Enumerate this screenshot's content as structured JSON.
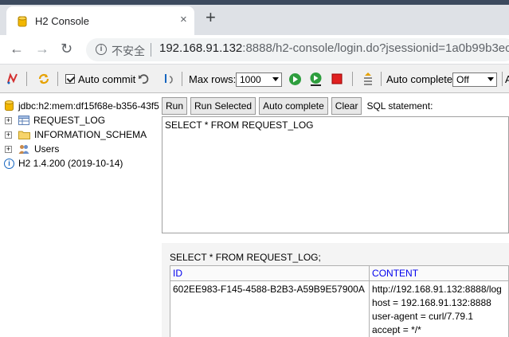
{
  "browser": {
    "tab_title": "H2 Console",
    "tab_close": "×",
    "new_tab": "+",
    "insecure_label": "不安全",
    "url_host": "192.168.91.132",
    "url_rest": ":8888/h2-console/login.do?jsessionid=1a0b99b3ec"
  },
  "toolbar": {
    "auto_commit_label": "Auto commit",
    "max_rows_label": "Max rows:",
    "max_rows_value": "1000",
    "auto_complete_label": "Auto complete",
    "auto_complete_value": "Off"
  },
  "tree": {
    "connection": "jdbc:h2:mem:df15f68e-b356-43f5",
    "items": [
      {
        "label": "REQUEST_LOG"
      },
      {
        "label": "INFORMATION_SCHEMA"
      },
      {
        "label": "Users"
      }
    ],
    "version": "H2 1.4.200 (2019-10-14)"
  },
  "query": {
    "run_label": "Run",
    "run_selected_label": "Run Selected",
    "auto_complete_label": "Auto complete",
    "clear_label": "Clear",
    "sql_statement_label": "SQL statement:",
    "sql_text": "SELECT * FROM REQUEST_LOG"
  },
  "result": {
    "title": "SELECT * FROM REQUEST_LOG;",
    "columns": [
      "ID",
      "CONTENT"
    ],
    "rows": [
      {
        "id": "602EE983-F145-4588-B2B3-A59B9E57900A",
        "content": [
          "http://192.168.91.132:8888/log",
          "host = 192.168.91.132:8888",
          "user-agent = curl/7.79.1",
          "accept = */*"
        ]
      }
    ]
  },
  "colors": {
    "header_link": "#0000ee",
    "toolbar_bg": "#f0f0f0",
    "tabstrip_bg": "#dee1e6"
  }
}
